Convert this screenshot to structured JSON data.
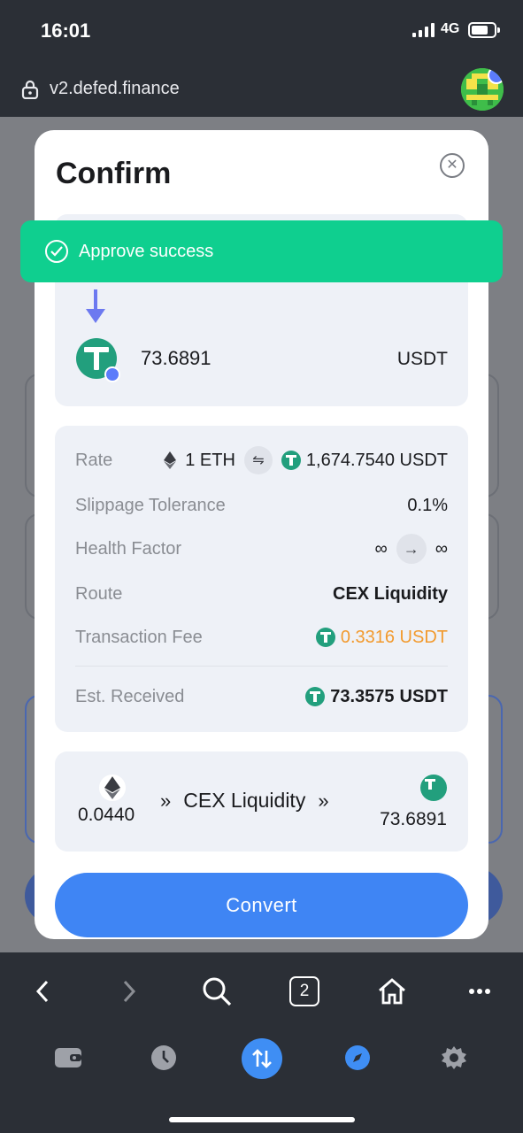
{
  "status_bar": {
    "time": "16:01",
    "network": "4G"
  },
  "browser": {
    "url": "v2.defed.finance",
    "tab_count": "2"
  },
  "modal": {
    "title": "Confirm",
    "to": {
      "amount": "73.6891",
      "symbol": "USDT"
    },
    "details": {
      "rate_label": "Rate",
      "rate_from": "1 ETH",
      "rate_to": "1,674.7540 USDT",
      "slippage_label": "Slippage Tolerance",
      "slippage_value": "0.1%",
      "health_label": "Health Factor",
      "health_from": "∞",
      "health_to": "∞",
      "route_label": "Route",
      "route_value": "CEX Liquidity",
      "fee_label": "Transaction Fee",
      "fee_value": "0.3316 USDT",
      "received_label": "Est. Received",
      "received_amount": "73.3575",
      "received_symbol": "USDT"
    },
    "route_path": {
      "from_amount": "0.0440",
      "via": "CEX Liquidity",
      "to_amount": "73.6891",
      "chevron": "»"
    },
    "convert_label": "Convert"
  },
  "toast": {
    "message": "Approve success"
  },
  "colors": {
    "accent": "#3f85f4",
    "success": "#0fcf8f",
    "usdt": "#229f7d",
    "fee": "#f29a2e"
  }
}
